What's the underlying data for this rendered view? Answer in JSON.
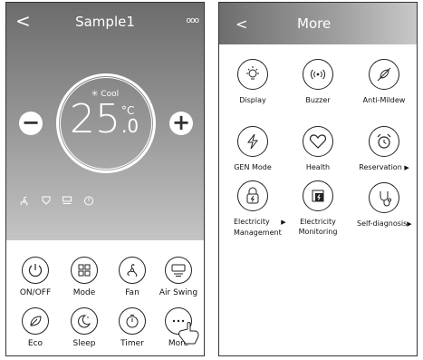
{
  "left": {
    "header": {
      "back": "<",
      "title": "Sample1",
      "menu": "ooo"
    },
    "dial": {
      "mode_icon": "✳",
      "mode": "Cool",
      "temp_int": "25",
      "temp_unit": "°C",
      "temp_dec": ".0"
    },
    "controls": {
      "minus": "−",
      "plus": "+"
    },
    "status_icons": [
      "fan-icon",
      "swing-icon",
      "display-icon",
      "timer-icon"
    ],
    "grid": [
      {
        "label": "ON/OFF",
        "icon": "power-icon"
      },
      {
        "label": "Mode",
        "icon": "mode-icon"
      },
      {
        "label": "Fan",
        "icon": "fan-icon"
      },
      {
        "label": "Air Swing",
        "icon": "air-swing-icon"
      },
      {
        "label": "Eco",
        "icon": "eco-icon"
      },
      {
        "label": "Sleep",
        "icon": "sleep-icon"
      },
      {
        "label": "Timer",
        "icon": "timer-icon"
      },
      {
        "label": "More",
        "icon": "more-icon"
      }
    ]
  },
  "right": {
    "header": {
      "back": "<",
      "title": "More"
    },
    "features": [
      {
        "label": "Display",
        "icon": "bulb-icon"
      },
      {
        "label": "Buzzer",
        "icon": "buzzer-icon"
      },
      {
        "label": "Anti-Mildew",
        "icon": "anti-mildew-icon"
      },
      {
        "label": "GEN Mode",
        "icon": "lightning-icon"
      },
      {
        "label": "Health",
        "icon": "heart-icon"
      },
      {
        "label": "Reservation",
        "icon": "alarm-clock-icon",
        "arrow": "▶"
      },
      {
        "label_1": "Electricity",
        "label_2": "Management",
        "icon": "electricity-lock-icon",
        "arrow": "▶"
      },
      {
        "label_1": "Electricity",
        "label_2": "Monitoring",
        "icon": "electricity-monitor-icon"
      },
      {
        "label": "Self-diagnosis",
        "icon": "stethoscope-icon",
        "arrow": "▶"
      }
    ]
  }
}
